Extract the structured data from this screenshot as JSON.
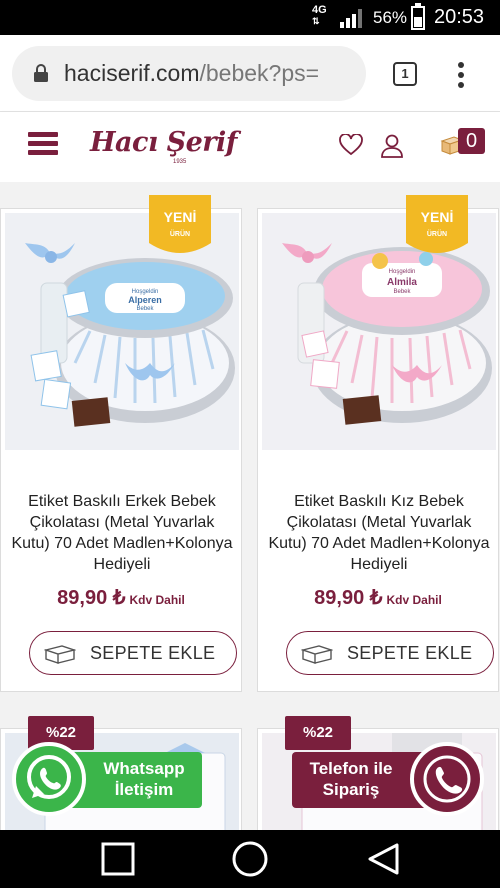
{
  "status_bar": {
    "network": "4G",
    "battery_percent": "56%",
    "battery_level": 0.56,
    "time": "20:53"
  },
  "browser": {
    "url_domain": "haciserif.com",
    "url_path": "/bebek?ps=",
    "tab_count": "1"
  },
  "header": {
    "logo_text": "Hacı Şerif",
    "logo_year": "1935",
    "cart_count": "0"
  },
  "products": [
    {
      "badge_line1": "YENİ",
      "badge_line2": "ÜRÜN",
      "title": "Etiket Baskılı Erkek Bebek Çikolatası (Metal Yuvarlak Kutu) 70 Adet Madlen+Kolonya Hediyeli",
      "price": "89,90 ₺",
      "price_note": "Kdv Dahil",
      "button_label": "SEPETE EKLE",
      "tin_line1": "Hoşgeldin",
      "tin_line2": "Alperen",
      "tin_line3": "Bebek"
    },
    {
      "badge_line1": "YENİ",
      "badge_line2": "ÜRÜN",
      "title": "Etiket Baskılı Kız Bebek Çikolatası (Metal Yuvarlak Kutu) 70 Adet Madlen+Kolonya Hediyeli",
      "price": "89,90 ₺",
      "price_note": "Kdv Dahil",
      "button_label": "SEPETE EKLE",
      "tin_line1": "Hoşgeldin",
      "tin_line2": "Almila",
      "tin_line3": "Bebek"
    }
  ],
  "next_products": [
    {
      "discount": "%22"
    },
    {
      "discount": "%22"
    }
  ],
  "floating": {
    "whatsapp_line1": "Whatsapp",
    "whatsapp_line2": "İletişim",
    "phone_line1": "Telefon ile",
    "phone_line2": "Sipariş"
  },
  "colors": {
    "brand": "#7a1f3d",
    "badge_gold": "#f2b924",
    "whatsapp_green": "#3bb54a"
  }
}
